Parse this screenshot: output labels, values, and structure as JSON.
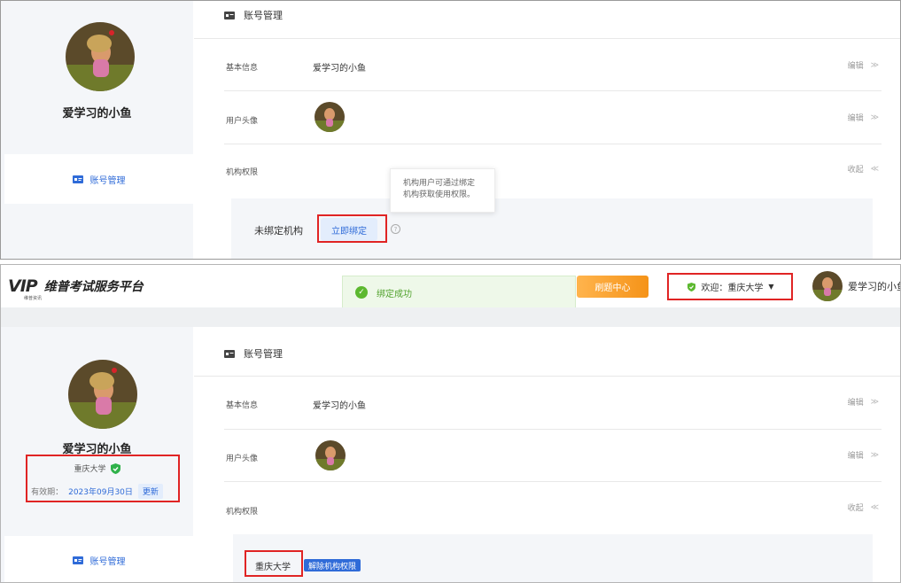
{
  "top": {
    "section_title": "账号管理",
    "username": "爱学习的小鱼",
    "nav_label": "账号管理",
    "rows": {
      "basic_label": "基本信息",
      "basic_value": "爱学习的小鱼",
      "basic_action": "编辑",
      "avatar_label": "用户头像",
      "avatar_action": "编辑",
      "perm_label": "机构权限",
      "perm_action": "收起"
    },
    "bind": {
      "status": "未绑定机构",
      "button": "立即绑定",
      "help": "?",
      "tooltip": "机构用户可通过绑定机构获取使用权限。"
    }
  },
  "bottom": {
    "logo_mark": "VIP",
    "logo_sub": "维普资讯",
    "logo_text": "维普考试服务平台",
    "toast": "绑定成功",
    "question_center": "刷题中心",
    "welcome": "欢迎：重庆大学",
    "top_username": "爱学习的小鱼",
    "section_title": "账号管理",
    "username": "爱学习的小鱼",
    "institution": "重庆大学",
    "validity_label": "有效期：",
    "validity_date": "2023年09月30日",
    "renew": "更新",
    "nav_label": "账号管理",
    "rows": {
      "basic_label": "基本信息",
      "basic_value": "爱学习的小鱼",
      "basic_action": "编辑",
      "avatar_label": "用户头像",
      "avatar_action": "编辑",
      "perm_label": "机构权限",
      "perm_action": "收起"
    },
    "bound_institution": "重庆大学",
    "unbind": "解除机构权限"
  },
  "icons": {
    "account": "id-card-icon",
    "collapse": "chevron-down-double-icon",
    "expand": "chevron-up-double-icon",
    "verified": "shield-check-icon",
    "success": "check-circle-icon"
  },
  "colors": {
    "accent": "#2f6bd8",
    "highlight": "#e02424",
    "success": "#5cb82f",
    "orange": "#f59318",
    "sidebar_bg": "#f4f6f9"
  }
}
